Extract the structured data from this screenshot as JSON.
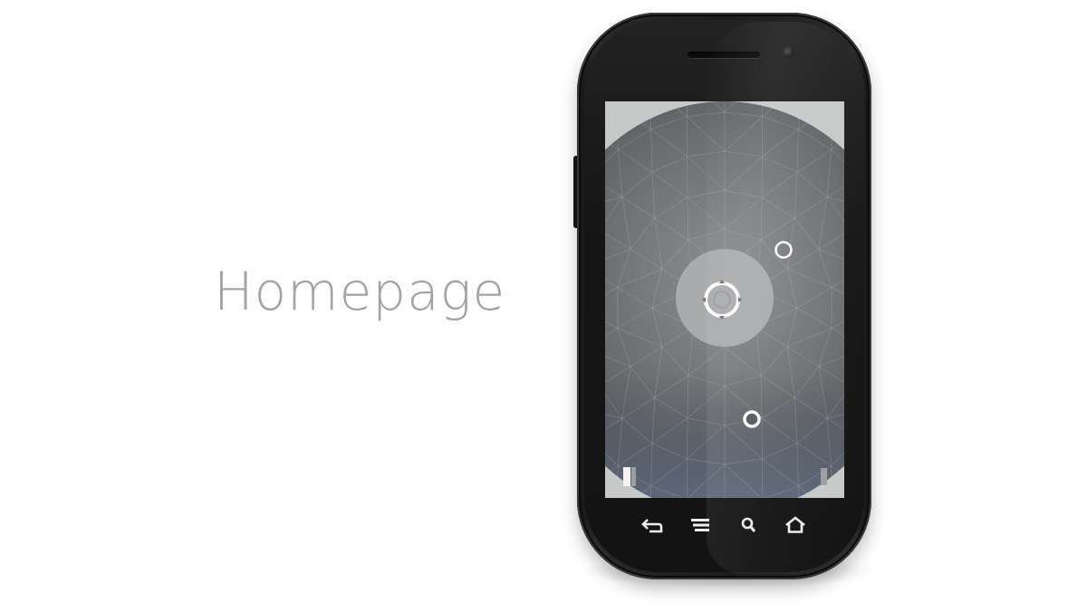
{
  "page": {
    "title": "Homepage"
  },
  "colors": {
    "title_text": "#a3a3a3",
    "phone_body": "#1c1c1c",
    "screen_base": "#c9cbcb",
    "sphere_dark": "#5a5c5e",
    "center_disc": "#a7a9ab",
    "ring_white": "#ffffff",
    "nav_icon": "#eeeeee"
  },
  "device": {
    "screen": {
      "hotspots": [
        {
          "name": "center-control",
          "icon": "ring-with-arrows-icon"
        },
        {
          "name": "upper-right-node",
          "icon": "ring-icon"
        },
        {
          "name": "lower-node",
          "icon": "ring-icon"
        }
      ],
      "status_indicators": [
        "left-status-bars",
        "right-status-bar"
      ]
    },
    "nav_keys": [
      {
        "name": "back",
        "icon": "back-arrow-icon"
      },
      {
        "name": "menu",
        "icon": "menu-lines-icon"
      },
      {
        "name": "search",
        "icon": "search-icon"
      },
      {
        "name": "home",
        "icon": "home-icon"
      }
    ]
  }
}
